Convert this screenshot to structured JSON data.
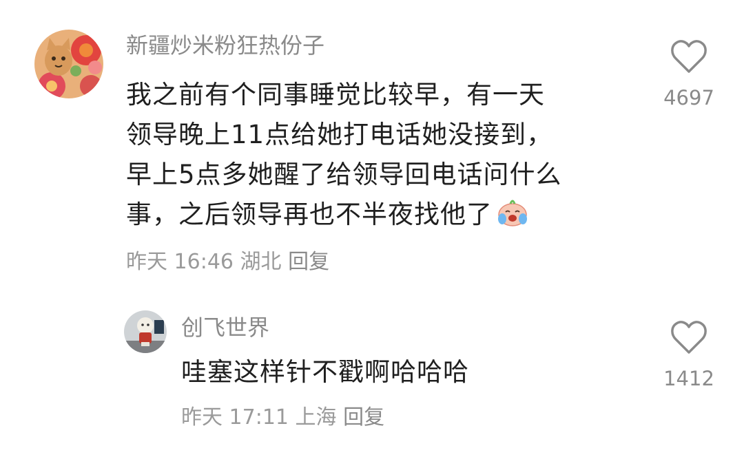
{
  "comments": [
    {
      "username": "新疆炒米粉狂热份子",
      "avatar_icon": "cat-flower-avatar",
      "lines": [
        "我之前有个同事睡觉比较早，有一天",
        "领导晚上11点给她打电话她没接到，",
        "早上5点多她醒了给领导回电话问什么",
        "事，之后领导再也不半夜找他了"
      ],
      "emoji": "crying-laughing-emoji",
      "time": "昨天 16:46",
      "location": "湖北",
      "reply_label": "回复",
      "likes": "4697"
    },
    {
      "username": "创飞世界",
      "avatar_icon": "figurine-avatar",
      "lines": [
        "哇塞这样针不戳啊哈哈哈"
      ],
      "time": "昨天 17:11",
      "location": "上海",
      "reply_label": "回复",
      "likes": "1412"
    }
  ],
  "colors": {
    "username": "#8a8a8a",
    "content": "#1f1f1f",
    "meta": "#9a9a9a",
    "background": "#ffffff"
  }
}
